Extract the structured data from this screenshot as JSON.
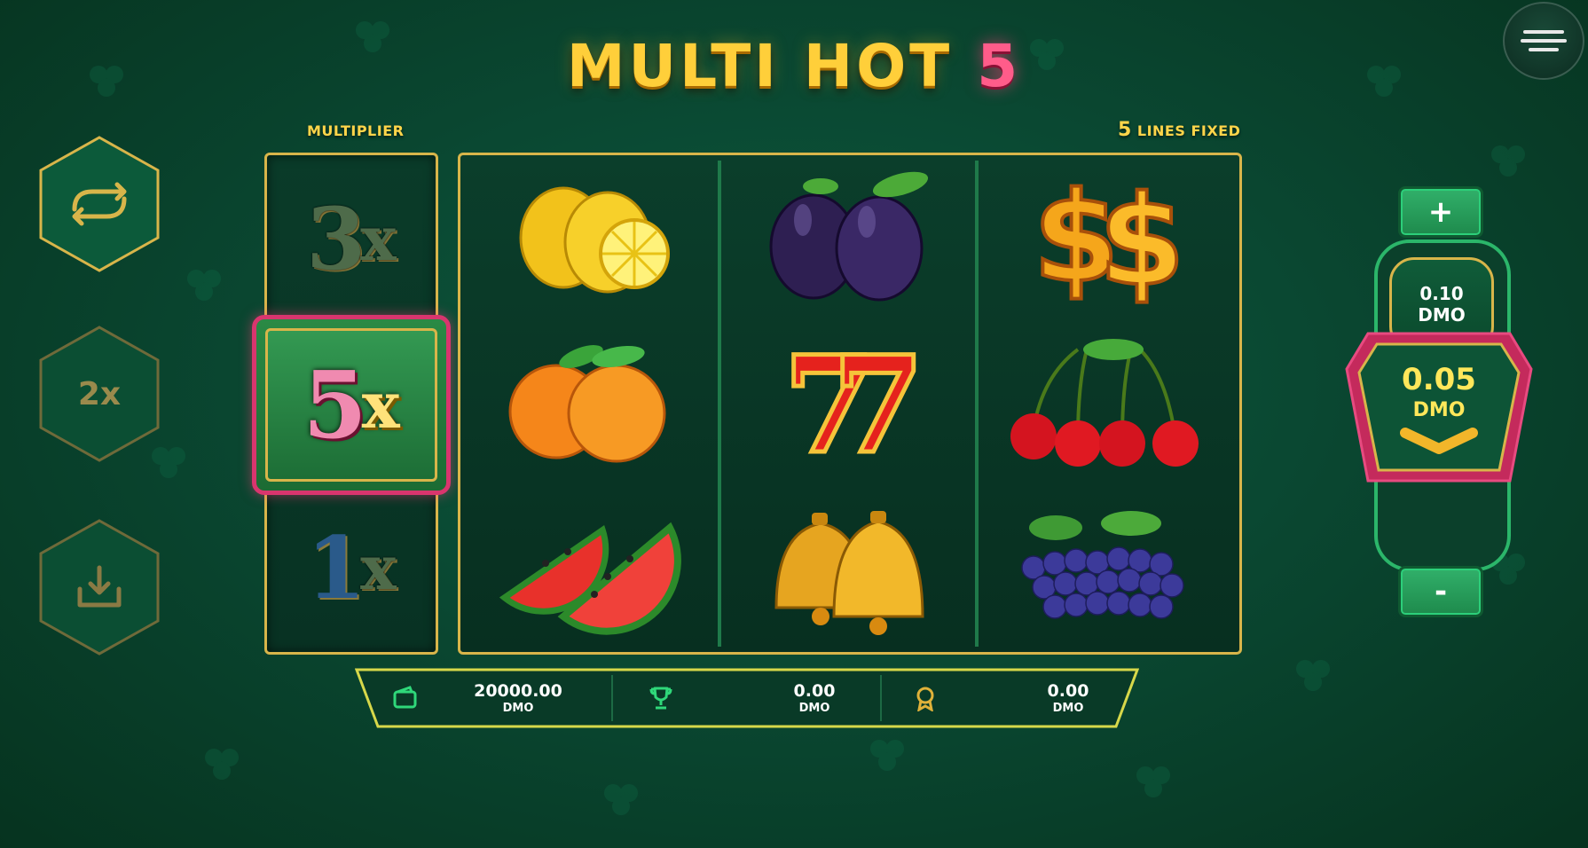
{
  "game": {
    "title_main": "MULTI HOT",
    "title_number": "5",
    "multiplier_label": "MULTIPLIER",
    "lines_number": "5",
    "lines_label": "LINES FIXED"
  },
  "side_buttons": [
    {
      "name": "autoplay",
      "icon": "repeat-icon"
    },
    {
      "name": "multiplier-2x",
      "label": "2x"
    },
    {
      "name": "collect",
      "icon": "download-tray-icon"
    }
  ],
  "multipliers": {
    "top": {
      "num": "3",
      "x": "x"
    },
    "active": {
      "num": "5",
      "x": "x"
    },
    "bottom": {
      "num": "1",
      "x": "x"
    }
  },
  "reels": [
    [
      "lemons",
      "oranges",
      "watermelons"
    ],
    [
      "plums",
      "sevens",
      "bells"
    ],
    [
      "dollars",
      "cherries",
      "grapes"
    ]
  ],
  "bottom_bar": {
    "balance": {
      "amount": "20000.00",
      "currency": "DMO",
      "icon": "wallet-icon"
    },
    "win": {
      "amount": "0.00",
      "currency": "DMO",
      "icon": "trophy-icon"
    },
    "bonus": {
      "amount": "0.00",
      "currency": "DMO",
      "icon": "medal-icon"
    }
  },
  "bet": {
    "plus": "+",
    "minus": "-",
    "next_value": "0.10",
    "next_currency": "DMO",
    "current_value": "0.05",
    "current_currency": "DMO"
  },
  "colors": {
    "gold": "#d8b54a",
    "accent_pink": "#d9356e",
    "felt_green": "#0a4832",
    "bet_yellow": "#ffe75a"
  }
}
